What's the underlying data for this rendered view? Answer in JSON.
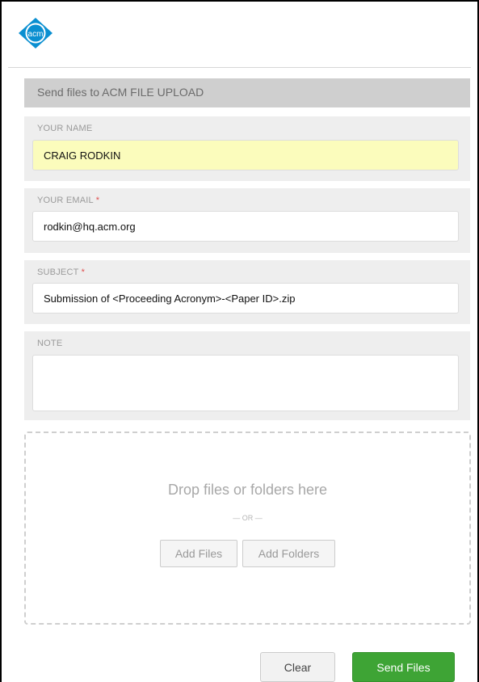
{
  "logo": {
    "text": "acm",
    "color": "#0a8fd1"
  },
  "form": {
    "header": "Send files to ACM FILE UPLOAD",
    "name": {
      "label": "YOUR NAME",
      "value": "CRAIG RODKIN"
    },
    "email": {
      "label": "YOUR EMAIL",
      "required_mark": "*",
      "value": "rodkin@hq.acm.org"
    },
    "subject": {
      "label": "SUBJECT",
      "required_mark": "*",
      "value": "Submission of <Proceeding Acronym>-<Paper ID>.zip"
    },
    "note": {
      "label": "NOTE",
      "value": ""
    }
  },
  "dropzone": {
    "title": "Drop files or folders here",
    "separator": "— OR —",
    "add_files": "Add Files",
    "add_folders": "Add Folders"
  },
  "actions": {
    "clear": "Clear",
    "send": "Send Files"
  },
  "colors": {
    "accent_green": "#3ea435",
    "required_red": "#e05050",
    "highlight_yellow": "#fbfcbc"
  }
}
